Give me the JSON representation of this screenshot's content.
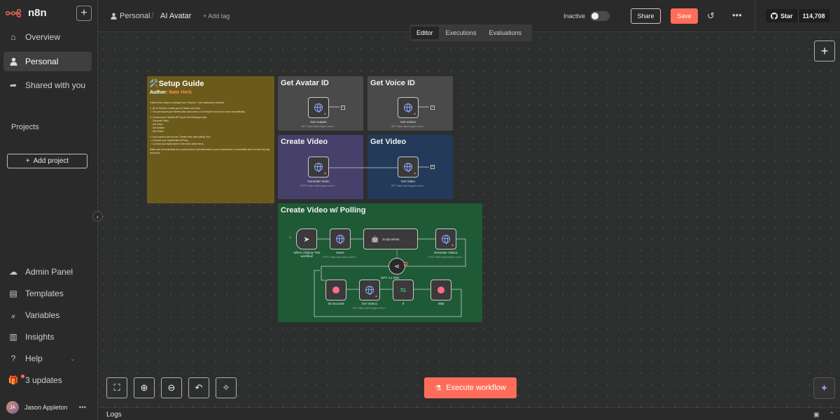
{
  "app": {
    "logo_text": "n8n"
  },
  "sidebar": {
    "items": [
      {
        "label": "Overview",
        "icon": "home-icon"
      },
      {
        "label": "Personal",
        "icon": "user-icon"
      },
      {
        "label": "Shared with you",
        "icon": "share-icon"
      }
    ],
    "projects_label": "Projects",
    "add_project_label": "Add project",
    "bottom_items": [
      {
        "label": "Admin Panel",
        "icon": "cloud-icon"
      },
      {
        "label": "Templates",
        "icon": "templates-icon"
      },
      {
        "label": "Variables",
        "icon": "variables-icon"
      },
      {
        "label": "Insights",
        "icon": "insights-icon"
      },
      {
        "label": "Help",
        "icon": "help-icon"
      },
      {
        "label": "3 updates",
        "icon": "gift-icon"
      }
    ],
    "user": {
      "initials": "JA",
      "name": "Jason Appleton"
    }
  },
  "header": {
    "breadcrumb_project": "Personal",
    "workflow_title": "AI Avatar",
    "add_tag": "+ Add tag",
    "status_label": "Inactive",
    "share_label": "Share",
    "save_label": "Save",
    "github_star": "Star",
    "github_count": "114,708"
  },
  "view_tabs": [
    "Editor",
    "Executions",
    "Evaluations"
  ],
  "notes": {
    "setup": {
      "title": "🛠️Setup Guide",
      "author_prefix": "Author: ",
      "author": "Nate Herk",
      "intro": "Follow these steps to configure your HeyGen + n8n automation workflow:",
      "step1": "1. Go to HeyGen, create your AI avatar and voice.",
      "step1a": "You can import your ElevenLabs voice clone, or let HeyGen clone your voice automatically.",
      "step2": "2. Connect your HeyGen API key to the following nodes:",
      "step2_nodes": [
        "Generate Video",
        "Get Video",
        "Get Avatars",
        "Get Voices"
      ],
      "step3": "3. If you want to test out the \"Create video with polling\" flow:",
      "step3a": "Connect your OpenRouter API key.",
      "step3b": "Connect your Apify token in the node called News.",
      "footer": "Make sure all credentials are properly stored and referenced in your environment or credentials store for best security and reuse."
    },
    "avatar": {
      "title": "Get Avatar ID",
      "node": "Get Avatars",
      "sub": "GET: https://api.heygen.com/v..."
    },
    "voice": {
      "title": "Get Voice ID",
      "node": "Get Voices",
      "sub": "GET: https://api.heygen.com/v..."
    },
    "create": {
      "title": "Create Video",
      "node": "Generate Video",
      "sub": "POST: https://api.heygen.com/v..."
    },
    "getvideo": {
      "title": "Get Video",
      "node": "Get Video",
      "sub": "GET: https://api.heygen.com/v..."
    },
    "polling": {
      "title": "Create Video w/ Polling",
      "nodes": {
        "trigger": "When clicking 'Test workflow'",
        "news": "News",
        "news_sub": "POST: https://api.apify.com/v2/...",
        "writer": "Script Writer",
        "generate": "Generate Video1",
        "generate_sub": "POST: https://api.heygen.com/v...",
        "model": "GPT 4.1 Mini",
        "wait30": "30 Seconds",
        "getvideo1": "Get Video1",
        "getvideo1_sub": "GET: https://api.heygen.com/v...",
        "if": "If",
        "wait": "Wait"
      }
    }
  },
  "canvas": {
    "execute_label": "Execute workflow"
  },
  "logs": {
    "label": "Logs"
  },
  "colors": {
    "accent": "#ff6d5a",
    "setup_note": "#6b5a1a",
    "gray_note": "#4a4a4a",
    "purple_note": "#46406b",
    "blue_note": "#233a5a",
    "green_note": "#1e5a36"
  }
}
